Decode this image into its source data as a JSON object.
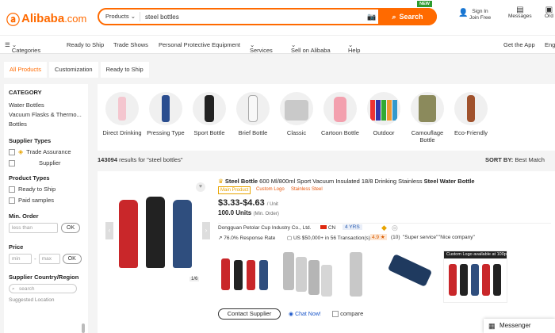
{
  "header": {
    "logo_text": "Alibaba",
    "logo_suffix": ".com",
    "search": {
      "category": "Products",
      "value": "steel bottles",
      "button": "Search",
      "badge": "NEW"
    },
    "signin": "Sign In",
    "join": "Join Free",
    "messages": "Messages",
    "orders": "Ord"
  },
  "nav": {
    "categories": "Categories",
    "items": [
      "Ready to Ship",
      "Trade Shows",
      "Personal Protective Equipment",
      "Services",
      "Sell on Alibaba",
      "Help"
    ],
    "get_app": "Get the App",
    "lang": "Eng"
  },
  "tabs": [
    "All Products",
    "Customization",
    "Ready to Ship"
  ],
  "sidebar": {
    "category_h": "CATEGORY",
    "categories": [
      "Water Bottles",
      "Vacuum Flasks & Thermo...",
      "Bottles"
    ],
    "supplier_types_h": "Supplier Types",
    "trade_assurance": "Trade Assurance",
    "verified_supplier": "Supplier",
    "product_types_h": "Product Types",
    "ready_to_ship": "Ready to Ship",
    "paid_samples": "Paid samples",
    "min_order_h": "Min. Order",
    "less_than": "less than",
    "ok": "OK",
    "price_h": "Price",
    "min": "min",
    "max": "max",
    "supplier_country_h": "Supplier Country/Region",
    "search_ph": "search",
    "suggested": "Suggested Location"
  },
  "category_strip": [
    "Direct Drinking",
    "Pressing Type",
    "Sport Bottle",
    "Brief Bottle",
    "Classic",
    "Cartoon Bottle",
    "Outdoor",
    "Camouflage Bottle",
    "Eco-Friendly"
  ],
  "results": {
    "count": "143094",
    "text": "results for \"steel bottles\""
  },
  "sort": {
    "label": "SORT BY:",
    "value": "Best Match"
  },
  "product": {
    "title_pre": "Steel Bottle",
    "title_rest": " 600 Ml/800ml Sport Vacuum Insulated 18/8 Drinking Stainless ",
    "title_bold2": "Steel Water Bottle",
    "badge_main": "Main Product",
    "badge_logo": "Custom Logo",
    "badge_steel": "Stainless Steel",
    "price": "$3.33-$4.63",
    "price_unit": "/ Unit",
    "moq": "100.0 Units",
    "moq_label": "(Min. Order)",
    "supplier": "Dongguan Petolar Cup Industry Co., Ltd.",
    "country": "CN",
    "years": "4 YRS",
    "response": "76.0% Response Rate",
    "transactions": "US $50,000+ in 56 Transaction(s)",
    "rating": "4.9",
    "reviews": "(10)",
    "review1": "\"Super service\"",
    "review2": "\"Nice company\"",
    "pager": "1/6",
    "custom_logo_banner": "Custom Logo available at 100pcs",
    "contact": "Contact Supplier",
    "chat": "Chat Now!",
    "compare": "compare"
  },
  "messenger": "Messenger"
}
